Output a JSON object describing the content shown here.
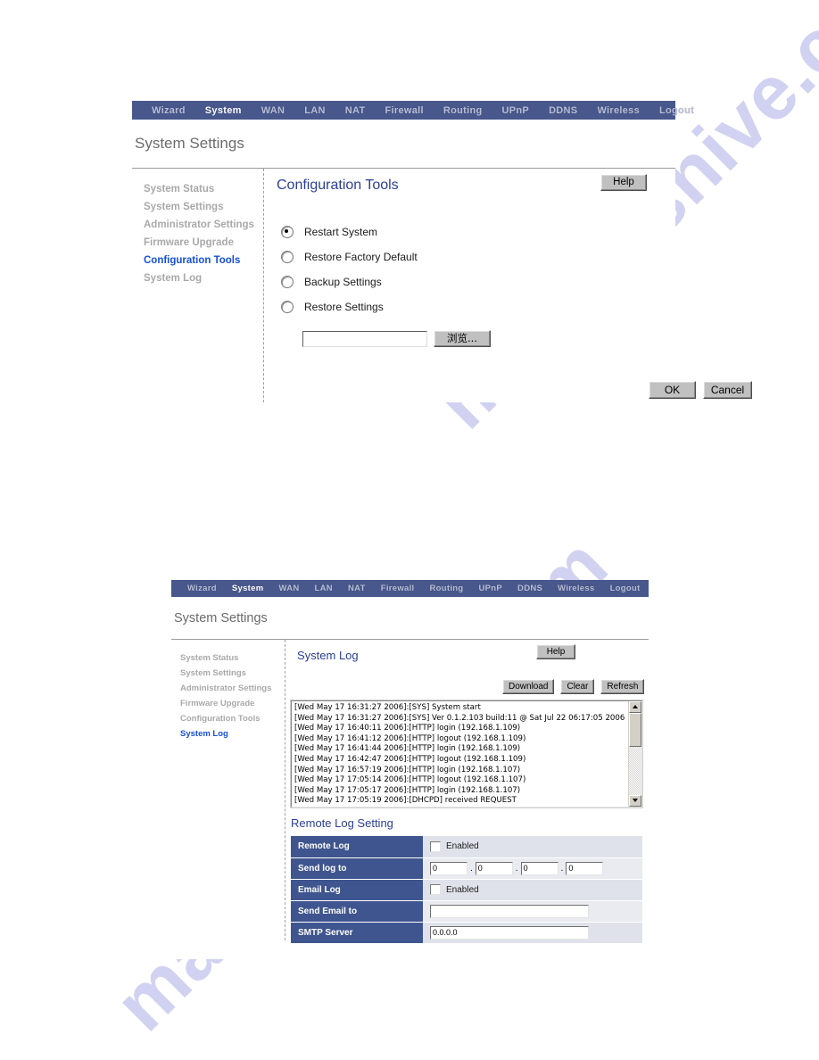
{
  "watermark": {
    "line1": "manualshive.com",
    "line2": "manualshive.com"
  },
  "navbar": {
    "items": [
      {
        "label": "Wizard",
        "active": false
      },
      {
        "label": "System",
        "active": true
      },
      {
        "label": "WAN",
        "active": false
      },
      {
        "label": "LAN",
        "active": false
      },
      {
        "label": "NAT",
        "active": false
      },
      {
        "label": "Firewall",
        "active": false
      },
      {
        "label": "Routing",
        "active": false
      },
      {
        "label": "UPnP",
        "active": false
      },
      {
        "label": "DDNS",
        "active": false
      },
      {
        "label": "Wireless",
        "active": false
      },
      {
        "label": "Logout",
        "active": false
      }
    ]
  },
  "page_title": "System Settings",
  "sidebar": {
    "items": [
      "System Status",
      "System Settings",
      "Administrator Settings",
      "Firmware Upgrade",
      "Configuration Tools",
      "System Log"
    ],
    "active_top": "Configuration Tools",
    "active_bottom": "System Log"
  },
  "config_tools": {
    "title": "Configuration Tools",
    "help_label": "Help",
    "options": [
      {
        "label": "Restart System",
        "selected": true
      },
      {
        "label": "Restore Factory Default",
        "selected": false
      },
      {
        "label": "Backup Settings",
        "selected": false
      },
      {
        "label": "Restore Settings",
        "selected": false
      }
    ],
    "file_value": "",
    "browse_label": "浏览...",
    "ok_label": "OK",
    "cancel_label": "Cancel"
  },
  "system_log": {
    "title": "System Log",
    "help_label": "Help",
    "buttons": {
      "download": "Download",
      "clear": "Clear",
      "refresh": "Refresh"
    },
    "lines": [
      "[Wed May 17 16:31:27 2006]:[SYS] System start",
      "[Wed May 17 16:31:27 2006]:[SYS] Ver 0.1.2.103 build:11 @ Sat Jul 22 06:17:05 2006",
      "[Wed May 17 16:40:11 2006]:[HTTP] login (192.168.1.109)",
      "[Wed May 17 16:41:12 2006]:[HTTP] logout (192.168.1.109)",
      "[Wed May 17 16:41:44 2006]:[HTTP] login (192.168.1.109)",
      "[Wed May 17 16:42:47 2006]:[HTTP] logout (192.168.1.109)",
      "[Wed May 17 16:57:19 2006]:[HTTP] login (192.168.1.107)",
      "[Wed May 17 17:05:14 2006]:[HTTP] logout (192.168.1.107)",
      "[Wed May 17 17:05:17 2006]:[HTTP] login (192.168.1.107)",
      "[Wed May 17 17:05:19 2006]:[DHCPD] received REQUEST"
    ]
  },
  "remote_log": {
    "title": "Remote Log Setting",
    "rows": {
      "remote_log_label": "Remote Log",
      "remote_log_enabled_label": "Enabled",
      "remote_log_enabled": false,
      "send_log_to_label": "Send log to",
      "send_log_to": [
        "0",
        "0",
        "0",
        "0"
      ],
      "email_log_label": "Email Log",
      "email_log_enabled_label": "Enabled",
      "email_log_enabled": false,
      "send_email_to_label": "Send Email to",
      "send_email_to": "",
      "smtp_server_label": "SMTP Server",
      "smtp_server": "0.0.0.0"
    }
  },
  "colors": {
    "nav_bg": "#48578c",
    "accent_blue": "#2b3f93",
    "active_link": "#1550d6",
    "table_header": "#3f558f",
    "watermark": "#c9cbef"
  }
}
